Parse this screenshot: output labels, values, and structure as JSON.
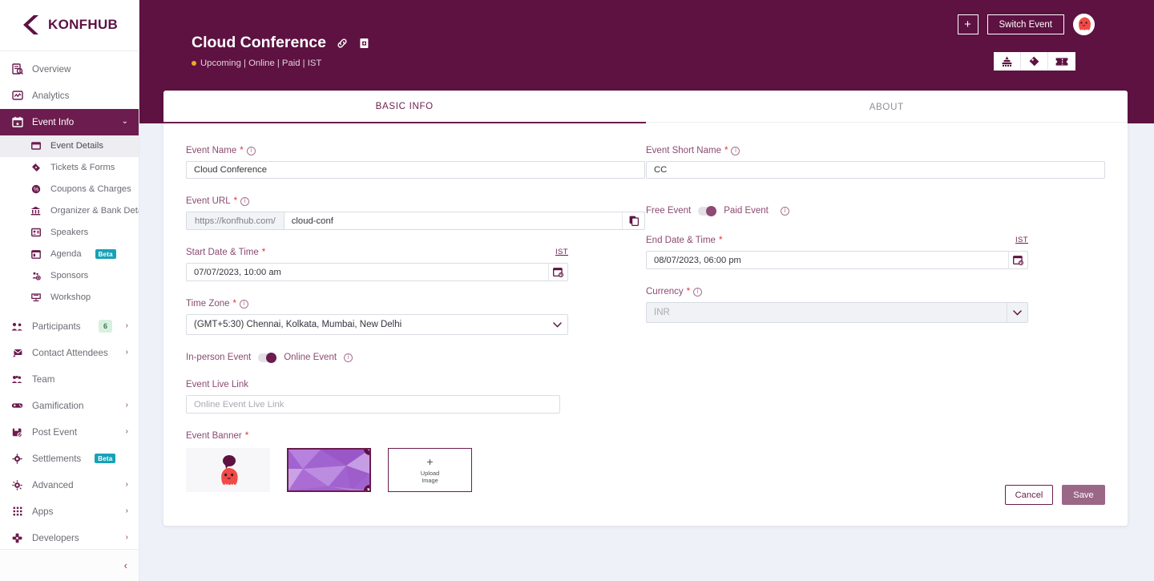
{
  "brand": {
    "name": "KONFHUB",
    "primary": "#5d1241",
    "accent": "#6c1c4e"
  },
  "sidebar": {
    "items": [
      {
        "label": "Overview",
        "icon": "overview-icon"
      },
      {
        "label": "Analytics",
        "icon": "analytics-icon"
      },
      {
        "label": "Event Info",
        "icon": "calendar-star-icon",
        "active": true,
        "chevron": "⌄"
      },
      {
        "label": "Event Details",
        "icon": "card-icon",
        "sub": true,
        "current": true
      },
      {
        "label": "Tickets & Forms",
        "icon": "ticket-icon",
        "sub": true
      },
      {
        "label": "Coupons & Charges",
        "icon": "coupon-icon",
        "sub": true
      },
      {
        "label": "Organizer & Bank Details",
        "icon": "bank-icon",
        "sub": true
      },
      {
        "label": "Speakers",
        "icon": "speaker-badge-icon",
        "sub": true
      },
      {
        "label": "Agenda",
        "icon": "agenda-calendar-icon",
        "sub": true,
        "badge": "Beta"
      },
      {
        "label": "Sponsors",
        "icon": "sponsors-icon",
        "sub": true
      },
      {
        "label": "Workshop",
        "icon": "workshop-icon",
        "sub": true
      },
      {
        "label": "Participants",
        "icon": "participants-icon",
        "count": "6",
        "chevron": "›"
      },
      {
        "label": "Contact Attendees",
        "icon": "mail-icon",
        "chevron": "›"
      },
      {
        "label": "Team",
        "icon": "team-icon"
      },
      {
        "label": "Gamification",
        "icon": "gamepad-icon",
        "chevron": "›"
      },
      {
        "label": "Post Event",
        "icon": "post-event-icon",
        "chevron": "›"
      },
      {
        "label": "Settlements",
        "icon": "settlements-icon",
        "badge": "Beta"
      },
      {
        "label": "Advanced",
        "icon": "gear-icon",
        "chevron": "›"
      },
      {
        "label": "Apps",
        "icon": "grid-apps-icon",
        "chevron": "›"
      },
      {
        "label": "Developers",
        "icon": "developers-icon",
        "chevron": "›"
      }
    ],
    "collapse": "‹"
  },
  "header": {
    "title": "Cloud Conference",
    "status_dot_color": "#f5a623",
    "subtitle": "Upcoming | Online | Paid | IST",
    "link_icon": "link-icon",
    "copy_page_icon": "duplicate-icon",
    "add_label": "+",
    "switch_event_label": "Switch Event",
    "quick_icons": [
      "sponsors-tier-icon",
      "tag-icon",
      "ticket-stub-icon"
    ]
  },
  "tabs": [
    {
      "label": "BASIC INFO",
      "active": true
    },
    {
      "label": "ABOUT",
      "active": false
    }
  ],
  "form": {
    "event_name": {
      "label": "Event Name",
      "required": true,
      "value": "Cloud Conference"
    },
    "event_short_name": {
      "label": "Event Short Name",
      "required": true,
      "value": "CC"
    },
    "event_url": {
      "label": "Event URL",
      "required": true,
      "prefix": "https://konfhub.com/",
      "value": "cloud-conf",
      "copy_icon": "copy-icon"
    },
    "pricing_toggle": {
      "left": "Free Event",
      "right": "Paid Event",
      "state": "paid"
    },
    "start_date": {
      "label": "Start Date & Time",
      "required": true,
      "tz_tag": "IST",
      "value": "07/07/2023, 10:00 am"
    },
    "end_date": {
      "label": "End Date & Time",
      "required": true,
      "tz_tag": "IST",
      "value": "08/07/2023, 06:00 pm"
    },
    "time_zone": {
      "label": "Time Zone",
      "required": true,
      "value": "(GMT+5:30) Chennai, Kolkata, Mumbai, New Delhi"
    },
    "currency": {
      "label": "Currency",
      "required": true,
      "placeholder": "INR",
      "disabled": true
    },
    "mode_toggle": {
      "left": "In-person Event",
      "right": "Online Event",
      "state": "online"
    },
    "live_link": {
      "label": "Event Live Link",
      "required": false,
      "value": "",
      "placeholder": "Online Event Live Link"
    },
    "banner": {
      "label": "Event Banner",
      "required": true,
      "upload_plus": "+",
      "upload_line1": "Upload",
      "upload_line2": "Image",
      "check_icon": "check-icon",
      "delete_icon": "trash-icon"
    }
  },
  "actions": {
    "cancel": "Cancel",
    "save": "Save"
  }
}
